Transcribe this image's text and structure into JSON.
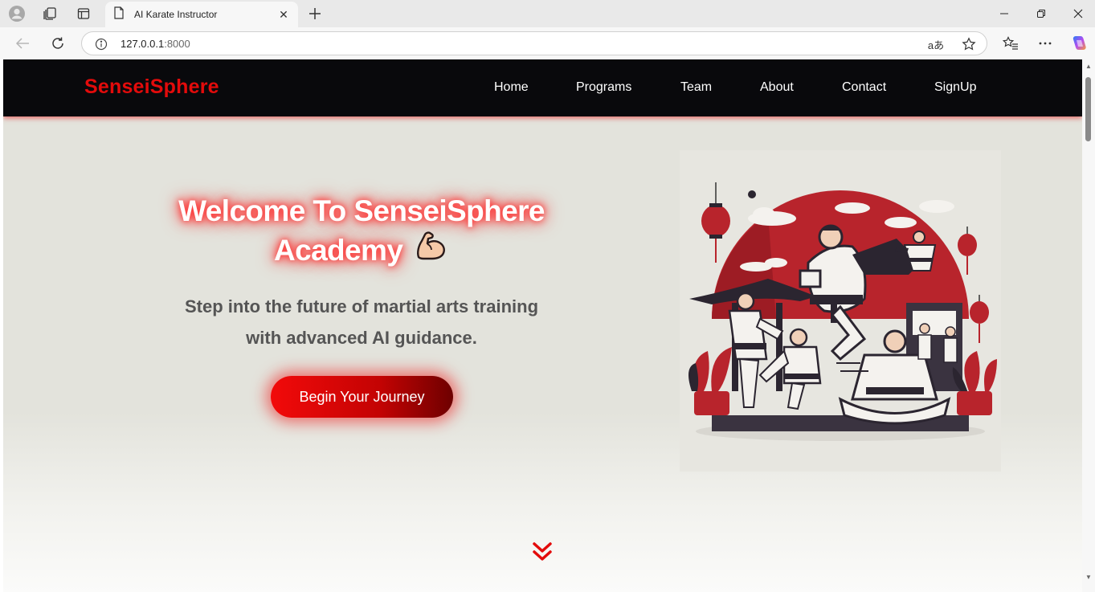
{
  "browser": {
    "tab_title": "AI Karate Instructor",
    "url_host": "127.0.0.1",
    "url_port": ":8000",
    "icons": [
      "profile-icon",
      "collections-icon",
      "tab-actions-icon",
      "page-icon",
      "close-icon",
      "new-tab-icon",
      "minimize-icon",
      "restore-icon",
      "close-window-icon",
      "back-icon",
      "refresh-icon",
      "info-icon",
      "read-aloud-icon",
      "favorite-icon",
      "favorites-icon",
      "more-icon",
      "copilot-icon"
    ],
    "read_aloud_label": "aあ"
  },
  "navbar": {
    "brand": "SenseiSphere",
    "links": [
      "Home",
      "Programs",
      "Team",
      "About",
      "Contact",
      "SignUp"
    ]
  },
  "hero": {
    "title_line1": "Welcome To SenseiSphere",
    "title_line2": "Academy",
    "title_emoji": "💪",
    "subtitle_line1": "Step into the future of martial arts training",
    "subtitle_line2": "with advanced AI guidance.",
    "cta_label": "Begin Your Journey"
  },
  "illustration": {
    "icon": "karate-dojo-illustration"
  },
  "scroll_indicator": {
    "icon": "double-chevron-down-icon"
  },
  "colors": {
    "brand_red": "#e30b0b",
    "navbar_bg": "#09090c",
    "hero_bg": "#e3e3dc",
    "subtitle": "#555555"
  }
}
